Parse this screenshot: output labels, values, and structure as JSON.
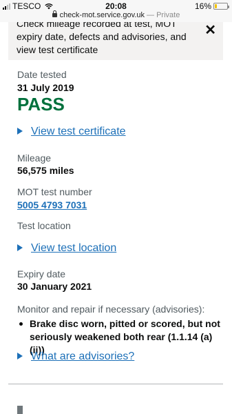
{
  "status_bar": {
    "carrier": "TESCO",
    "time": "20:08",
    "battery": "16%",
    "battery_level": 0.16,
    "url": "check-mot.service.gov.uk",
    "url_suffix": "— Private"
  },
  "info_box": {
    "text": "Check mileage recorded at test, MOT expiry date, defects and advisories, and view test certificate",
    "close_glyph": "✕"
  },
  "test": {
    "date_label": "Date tested",
    "date_value": "31 July 2019",
    "result": "PASS",
    "certificate_link": "View test certificate",
    "mileage_label": "Mileage",
    "mileage_value": "56,575 miles",
    "test_number_label": "MOT test number",
    "test_number_value": "5005 4793 7031",
    "location_label": "Test location",
    "location_link": "View test location",
    "expiry_label": "Expiry date",
    "expiry_value": "30 January 2021",
    "advisories_label": "Monitor and repair if necessary (advisories):",
    "advisories": [
      "Brake disc worn, pitted or scored, but not seriously weakened both rear (1.1.14 (a) (ii))"
    ],
    "advisories_link": "What are advisories?"
  },
  "icons": {
    "signal": "signal-icon",
    "wifi": "wifi-icon",
    "lock": "lock-icon",
    "battery": "battery-icon",
    "close": "close-icon",
    "disclosure": "triangle-right-icon"
  },
  "colors": {
    "pass_green": "#00703c",
    "link_blue": "#1d70b8",
    "label_grey": "#505a5f",
    "panel_grey": "#f3f2f1"
  }
}
